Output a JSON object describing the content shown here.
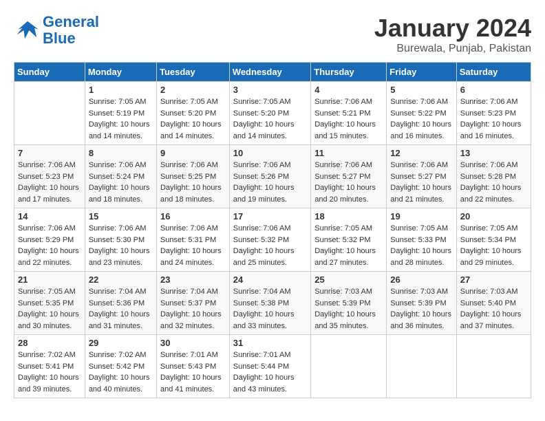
{
  "header": {
    "logo_line1": "General",
    "logo_line2": "Blue",
    "month_title": "January 2024",
    "location": "Burewala, Punjab, Pakistan"
  },
  "weekdays": [
    "Sunday",
    "Monday",
    "Tuesday",
    "Wednesday",
    "Thursday",
    "Friday",
    "Saturday"
  ],
  "weeks": [
    [
      {
        "day": "",
        "sunrise": "",
        "sunset": "",
        "daylight": ""
      },
      {
        "day": "1",
        "sunrise": "Sunrise: 7:05 AM",
        "sunset": "Sunset: 5:19 PM",
        "daylight": "Daylight: 10 hours and 14 minutes."
      },
      {
        "day": "2",
        "sunrise": "Sunrise: 7:05 AM",
        "sunset": "Sunset: 5:20 PM",
        "daylight": "Daylight: 10 hours and 14 minutes."
      },
      {
        "day": "3",
        "sunrise": "Sunrise: 7:05 AM",
        "sunset": "Sunset: 5:20 PM",
        "daylight": "Daylight: 10 hours and 14 minutes."
      },
      {
        "day": "4",
        "sunrise": "Sunrise: 7:06 AM",
        "sunset": "Sunset: 5:21 PM",
        "daylight": "Daylight: 10 hours and 15 minutes."
      },
      {
        "day": "5",
        "sunrise": "Sunrise: 7:06 AM",
        "sunset": "Sunset: 5:22 PM",
        "daylight": "Daylight: 10 hours and 16 minutes."
      },
      {
        "day": "6",
        "sunrise": "Sunrise: 7:06 AM",
        "sunset": "Sunset: 5:23 PM",
        "daylight": "Daylight: 10 hours and 16 minutes."
      }
    ],
    [
      {
        "day": "7",
        "sunrise": "Sunrise: 7:06 AM",
        "sunset": "Sunset: 5:23 PM",
        "daylight": "Daylight: 10 hours and 17 minutes."
      },
      {
        "day": "8",
        "sunrise": "Sunrise: 7:06 AM",
        "sunset": "Sunset: 5:24 PM",
        "daylight": "Daylight: 10 hours and 18 minutes."
      },
      {
        "day": "9",
        "sunrise": "Sunrise: 7:06 AM",
        "sunset": "Sunset: 5:25 PM",
        "daylight": "Daylight: 10 hours and 18 minutes."
      },
      {
        "day": "10",
        "sunrise": "Sunrise: 7:06 AM",
        "sunset": "Sunset: 5:26 PM",
        "daylight": "Daylight: 10 hours and 19 minutes."
      },
      {
        "day": "11",
        "sunrise": "Sunrise: 7:06 AM",
        "sunset": "Sunset: 5:27 PM",
        "daylight": "Daylight: 10 hours and 20 minutes."
      },
      {
        "day": "12",
        "sunrise": "Sunrise: 7:06 AM",
        "sunset": "Sunset: 5:27 PM",
        "daylight": "Daylight: 10 hours and 21 minutes."
      },
      {
        "day": "13",
        "sunrise": "Sunrise: 7:06 AM",
        "sunset": "Sunset: 5:28 PM",
        "daylight": "Daylight: 10 hours and 22 minutes."
      }
    ],
    [
      {
        "day": "14",
        "sunrise": "Sunrise: 7:06 AM",
        "sunset": "Sunset: 5:29 PM",
        "daylight": "Daylight: 10 hours and 22 minutes."
      },
      {
        "day": "15",
        "sunrise": "Sunrise: 7:06 AM",
        "sunset": "Sunset: 5:30 PM",
        "daylight": "Daylight: 10 hours and 23 minutes."
      },
      {
        "day": "16",
        "sunrise": "Sunrise: 7:06 AM",
        "sunset": "Sunset: 5:31 PM",
        "daylight": "Daylight: 10 hours and 24 minutes."
      },
      {
        "day": "17",
        "sunrise": "Sunrise: 7:06 AM",
        "sunset": "Sunset: 5:32 PM",
        "daylight": "Daylight: 10 hours and 25 minutes."
      },
      {
        "day": "18",
        "sunrise": "Sunrise: 7:05 AM",
        "sunset": "Sunset: 5:32 PM",
        "daylight": "Daylight: 10 hours and 27 minutes."
      },
      {
        "day": "19",
        "sunrise": "Sunrise: 7:05 AM",
        "sunset": "Sunset: 5:33 PM",
        "daylight": "Daylight: 10 hours and 28 minutes."
      },
      {
        "day": "20",
        "sunrise": "Sunrise: 7:05 AM",
        "sunset": "Sunset: 5:34 PM",
        "daylight": "Daylight: 10 hours and 29 minutes."
      }
    ],
    [
      {
        "day": "21",
        "sunrise": "Sunrise: 7:05 AM",
        "sunset": "Sunset: 5:35 PM",
        "daylight": "Daylight: 10 hours and 30 minutes."
      },
      {
        "day": "22",
        "sunrise": "Sunrise: 7:04 AM",
        "sunset": "Sunset: 5:36 PM",
        "daylight": "Daylight: 10 hours and 31 minutes."
      },
      {
        "day": "23",
        "sunrise": "Sunrise: 7:04 AM",
        "sunset": "Sunset: 5:37 PM",
        "daylight": "Daylight: 10 hours and 32 minutes."
      },
      {
        "day": "24",
        "sunrise": "Sunrise: 7:04 AM",
        "sunset": "Sunset: 5:38 PM",
        "daylight": "Daylight: 10 hours and 33 minutes."
      },
      {
        "day": "25",
        "sunrise": "Sunrise: 7:03 AM",
        "sunset": "Sunset: 5:39 PM",
        "daylight": "Daylight: 10 hours and 35 minutes."
      },
      {
        "day": "26",
        "sunrise": "Sunrise: 7:03 AM",
        "sunset": "Sunset: 5:39 PM",
        "daylight": "Daylight: 10 hours and 36 minutes."
      },
      {
        "day": "27",
        "sunrise": "Sunrise: 7:03 AM",
        "sunset": "Sunset: 5:40 PM",
        "daylight": "Daylight: 10 hours and 37 minutes."
      }
    ],
    [
      {
        "day": "28",
        "sunrise": "Sunrise: 7:02 AM",
        "sunset": "Sunset: 5:41 PM",
        "daylight": "Daylight: 10 hours and 39 minutes."
      },
      {
        "day": "29",
        "sunrise": "Sunrise: 7:02 AM",
        "sunset": "Sunset: 5:42 PM",
        "daylight": "Daylight: 10 hours and 40 minutes."
      },
      {
        "day": "30",
        "sunrise": "Sunrise: 7:01 AM",
        "sunset": "Sunset: 5:43 PM",
        "daylight": "Daylight: 10 hours and 41 minutes."
      },
      {
        "day": "31",
        "sunrise": "Sunrise: 7:01 AM",
        "sunset": "Sunset: 5:44 PM",
        "daylight": "Daylight: 10 hours and 43 minutes."
      },
      {
        "day": "",
        "sunrise": "",
        "sunset": "",
        "daylight": ""
      },
      {
        "day": "",
        "sunrise": "",
        "sunset": "",
        "daylight": ""
      },
      {
        "day": "",
        "sunrise": "",
        "sunset": "",
        "daylight": ""
      }
    ]
  ]
}
